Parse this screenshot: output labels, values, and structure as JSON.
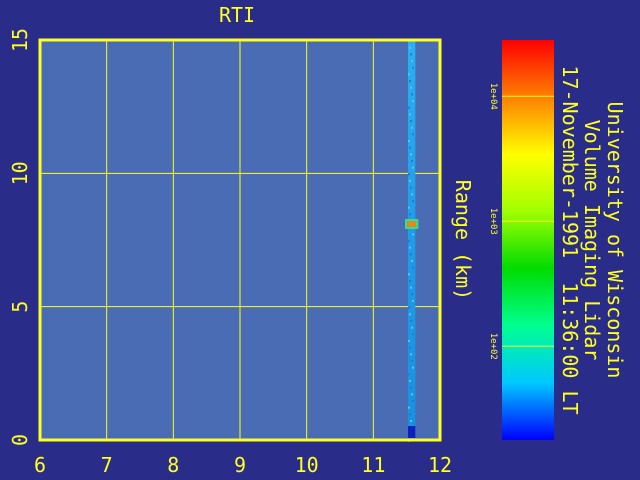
{
  "chart_data": {
    "type": "heatmap",
    "title": "RTI",
    "xlabel": "",
    "ylabel": "Range (km)",
    "xlim": [
      6,
      12
    ],
    "ylim": [
      0,
      15
    ],
    "x_ticks": [
      "6",
      "7",
      "8",
      "9",
      "10",
      "11",
      "12"
    ],
    "y_ticks": [
      "0",
      "5",
      "10",
      "15"
    ],
    "grid": true,
    "background_value_color": "#4a6cb4",
    "data_strip": {
      "x_start": 11.52,
      "x_end": 11.63,
      "range_km": [
        0,
        15
      ],
      "dominant_value": 300,
      "features": [
        {
          "range_km": 8.1,
          "value": 5000,
          "color": "#e08a20"
        },
        {
          "range_km": 0.3,
          "value": 100,
          "color": "#1020c0"
        }
      ]
    },
    "colorbar": {
      "scale": "log",
      "ticks": [
        "1e+02",
        "1e+03",
        "1e+04"
      ],
      "colors": [
        "#0000ff",
        "#00c8ff",
        "#00ff90",
        "#00dc00",
        "#a0ff00",
        "#ffff00",
        "#ff8000",
        "#ff0000"
      ]
    }
  },
  "annotation": {
    "line1": "University of Wisconsin",
    "line2": "Volume Imaging Lidar",
    "line3": "17-November-1991  11:36:00 LT"
  },
  "colors": {
    "background": "#2a2c8a",
    "plot_fill": "#4a6cb4",
    "axis": "#ffff20"
  }
}
